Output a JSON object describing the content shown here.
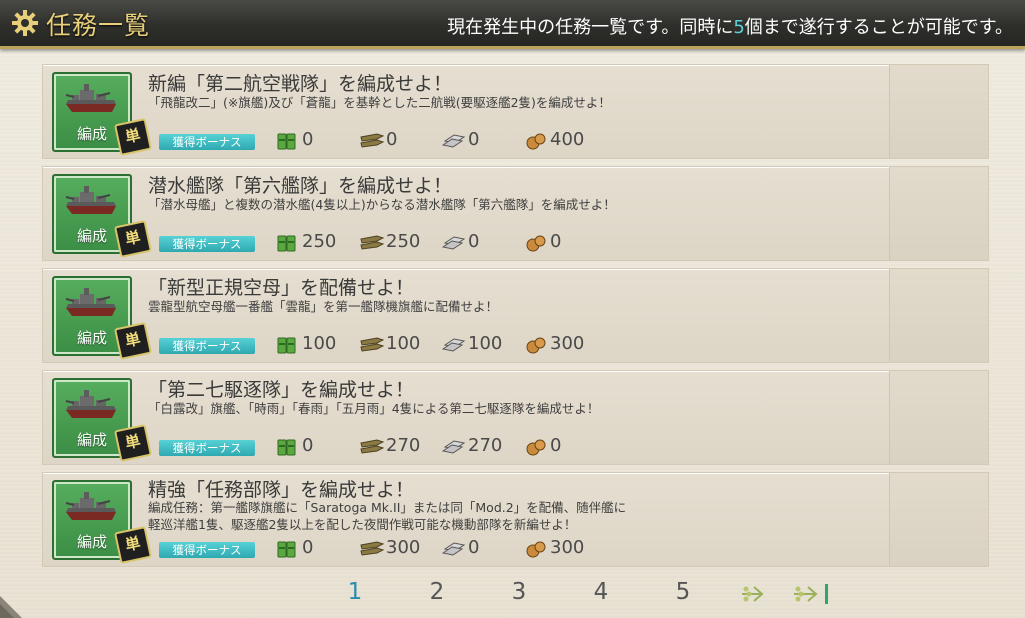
{
  "header": {
    "title": "任務一覧",
    "desc_pre": "現在発生中の任務一覧です。同時に",
    "desc_num": "5",
    "desc_post": "個まで遂行することが可能です。"
  },
  "quests": [
    {
      "category": "編成",
      "badge": "単",
      "title": "新編「第二航空戦隊」を編成せよ！",
      "desc": [
        "「飛龍改二」(※旗艦)及び「蒼龍」を基幹とした二航戦(要駆逐艦2隻)を編成せよ！"
      ],
      "bonus": "獲得ボーナス",
      "fuel": "0",
      "ammo": "0",
      "steel": "0",
      "bauxite": "400"
    },
    {
      "category": "編成",
      "badge": "単",
      "title": "潜水艦隊「第六艦隊」を編成せよ！",
      "desc": [
        "「潜水母艦」と複数の潜水艦(4隻以上)からなる潜水艦隊「第六艦隊」を編成せよ！"
      ],
      "bonus": "獲得ボーナス",
      "fuel": "250",
      "ammo": "250",
      "steel": "0",
      "bauxite": "0"
    },
    {
      "category": "編成",
      "badge": "単",
      "title": "「新型正規空母」を配備せよ！",
      "desc": [
        "雲龍型航空母艦一番艦「雲龍」を第一艦隊機旗艦に配備せよ！"
      ],
      "bonus": "獲得ボーナス",
      "fuel": "100",
      "ammo": "100",
      "steel": "100",
      "bauxite": "300"
    },
    {
      "category": "編成",
      "badge": "単",
      "title": "「第二七駆逐隊」を編成せよ！",
      "desc": [
        "「白露改」旗艦、「時雨」「春雨」「五月雨」4隻による第二七駆逐隊を編成せよ！"
      ],
      "bonus": "獲得ボーナス",
      "fuel": "0",
      "ammo": "270",
      "steel": "270",
      "bauxite": "0"
    },
    {
      "category": "編成",
      "badge": "単",
      "title": "精強「任務部隊」を編成せよ！",
      "desc": [
        "編成任務：第一艦隊旗艦に「Saratoga Mk.II」または同「Mod.2」を配備、随伴艦に",
        "軽巡洋艦1隻、駆逐艦2隻以上を配した夜間作戦可能な機動部隊を新編せよ！"
      ],
      "bonus": "獲得ボーナス",
      "fuel": "0",
      "ammo": "300",
      "steel": "0",
      "bauxite": "300"
    }
  ],
  "pager": {
    "pages": [
      "1",
      "2",
      "3",
      "4",
      "5"
    ],
    "current": "1"
  },
  "colors": {
    "header_title": "#e8cf7a",
    "highlight": "#5fd0d6",
    "category_green": "#3b8e45",
    "bonus_cyan": "#2fa9b0",
    "active_page": "#2a8bb0"
  },
  "icons": {
    "header": "gear-icon",
    "quest_category": "ship-icon",
    "fuel": "fuel-icon",
    "ammo": "ammo-icon",
    "steel": "steel-icon",
    "bauxite": "bauxite-icon",
    "next": "next-page-icon",
    "last": "last-page-icon"
  }
}
